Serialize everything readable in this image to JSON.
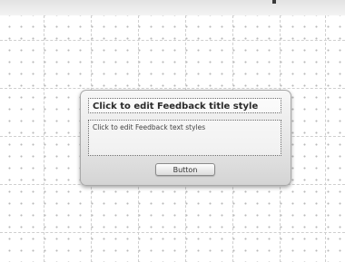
{
  "feedback_dialog": {
    "title": "Click to edit Feedback title style",
    "body_text": "Click to edit Feedback text styles",
    "button_label": "Button"
  },
  "colors": {
    "canvas_background": "#ffffff",
    "dialog_gradient_top": "#f7f7f7",
    "dialog_gradient_bottom": "#d4d4d4",
    "dotted_border": "#6a6a6a"
  }
}
